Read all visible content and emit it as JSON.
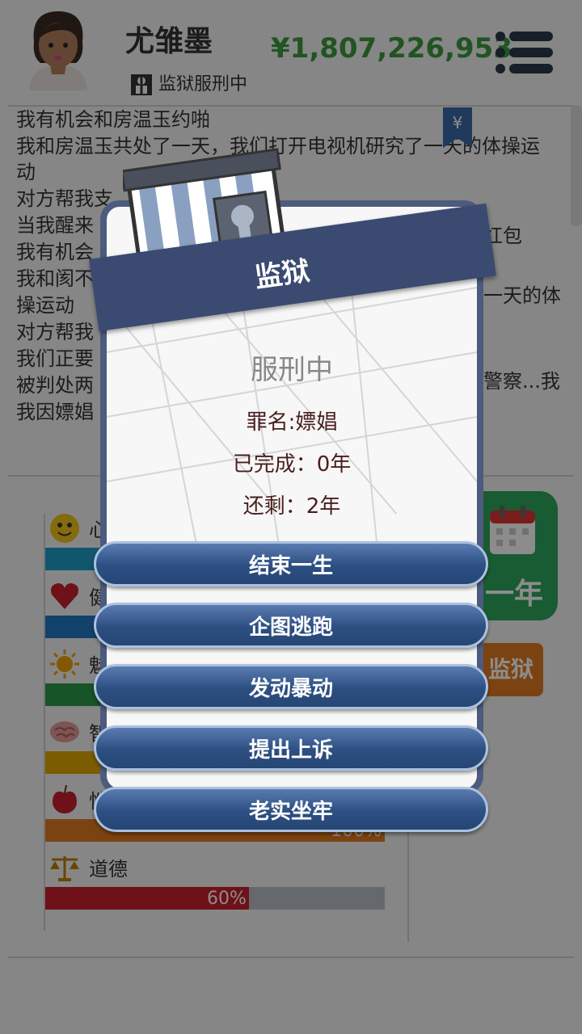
{
  "header": {
    "name": "尤雏墨",
    "status": "监狱服刑中",
    "money": "¥1,807,226,953"
  },
  "log": [
    "我有机会和房温玉约啪",
    "我和房温玉共处了一天，我们打开电视机研究了一天的体操运动",
    "对方帮我支",
    "当我醒来",
    "我有机会",
    "我和阂不",
    "操运动",
    "对方帮我",
    "我们正要",
    "被判处两",
    "我因嫖娼"
  ],
  "log_right_fragments": {
    "line4": "红包",
    "line6": "一天的体",
    "line9": "警察...我"
  },
  "stats": [
    {
      "label": "心",
      "icon": "smiley-icon",
      "percent": 100,
      "color": "#1e9ec6"
    },
    {
      "label": "健",
      "icon": "heart-icon",
      "percent": 100,
      "color": "#1f78c4"
    },
    {
      "label": "魅",
      "icon": "sun-icon",
      "percent": 100,
      "color": "#2a9a47"
    },
    {
      "label": "智",
      "icon": "brain-icon",
      "percent": 100,
      "color": "#e0a800"
    },
    {
      "label": "性",
      "icon": "apple-icon",
      "percent": 100,
      "pct_text": "100%",
      "color": "#e07a1f"
    },
    {
      "label": "道德",
      "icon": "scales-icon",
      "percent": 60,
      "pct_text": "60%",
      "color": "#c8202d"
    }
  ],
  "year_button": "一年",
  "jail_button": "监狱",
  "dialog": {
    "title": "监狱",
    "status": "服刑中",
    "crime": "罪名:嫖娼",
    "completed": "已完成：0年",
    "remaining": "还剩：2年",
    "actions": [
      "结束一生",
      "企图逃跑",
      "发动暴动",
      "提出上诉",
      "老实坐牢"
    ]
  },
  "colors": {
    "money": "#3d9a3d",
    "banner": "#3a4a70",
    "action_button": "#2c4f82",
    "year_button": "#2fa65e",
    "jail_button": "#e07a1f"
  }
}
